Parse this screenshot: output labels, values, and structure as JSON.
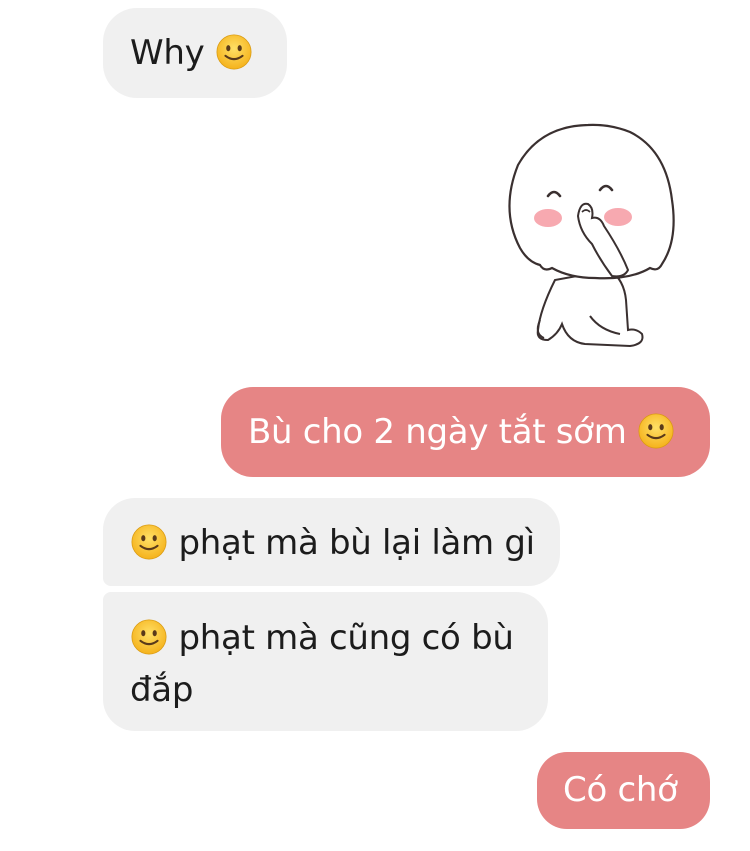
{
  "messages": [
    {
      "side": "incoming",
      "text": "Why",
      "emoji": "slightly-smiling-face-emoji"
    },
    {
      "side": "outgoing",
      "sticker": "shy-ghost-sticker"
    },
    {
      "side": "outgoing",
      "text": "Bù cho 2 ngày tắt sớm",
      "emoji": "slightly-smiling-face-emoji"
    },
    {
      "side": "incoming",
      "emoji": "slightly-smiling-face-emoji",
      "text": "phạt mà bù lại làm gì"
    },
    {
      "side": "incoming",
      "emoji": "slightly-smiling-face-emoji",
      "text_line1": "phạt mà cũng có bù",
      "text_line2": "đắp"
    },
    {
      "side": "outgoing",
      "text": "Có chớ"
    }
  ],
  "colors": {
    "incoming_bubble": "#f0f0f0",
    "outgoing_bubble": "#e68585",
    "incoming_text": "#1c1c1c",
    "outgoing_text": "#ffffff"
  }
}
